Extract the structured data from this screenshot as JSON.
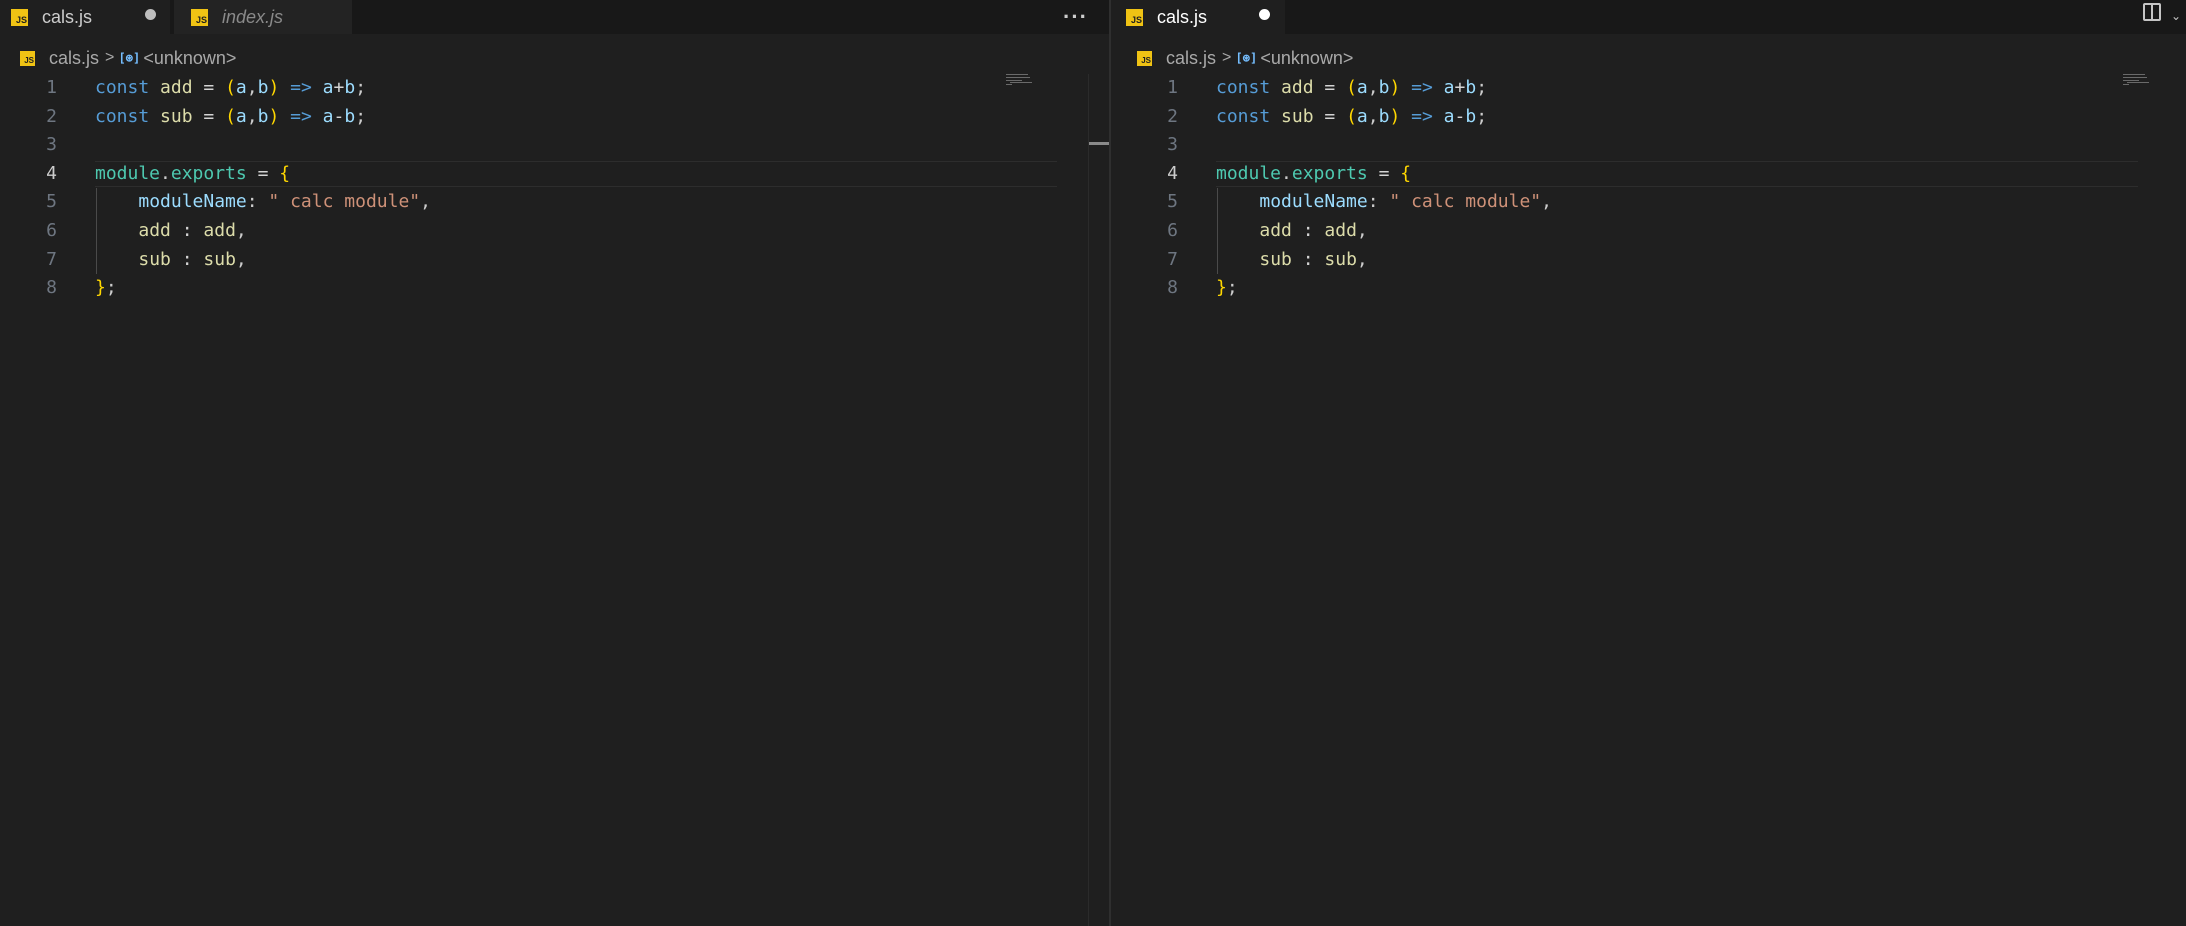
{
  "left_pane": {
    "tabs": [
      {
        "label": "cals.js",
        "badge": "JS",
        "dirty": true,
        "active": true
      },
      {
        "label": "index.js",
        "badge": "JS",
        "dirty": false,
        "active": false,
        "preview": true
      }
    ],
    "more_actions": "···",
    "breadcrumb": {
      "file": "cals.js",
      "separator": ">",
      "symbol_icon": "symbol-variable-icon",
      "symbol": "<unknown>"
    }
  },
  "right_pane": {
    "tabs": [
      {
        "label": "cals.js",
        "badge": "JS",
        "dirty": true,
        "active": true
      }
    ],
    "breadcrumb": {
      "file": "cals.js",
      "separator": ">",
      "symbol_icon": "symbol-variable-icon",
      "symbol": "<unknown>"
    },
    "actions": {
      "split_editor_icon": "split-editor-icon"
    }
  },
  "editor": {
    "active_line": 4,
    "lines": [
      {
        "n": "1",
        "t": [
          "const",
          " ",
          "add",
          " = ",
          "(",
          "a",
          ",",
          "b",
          ")",
          " ",
          "=>",
          " ",
          "a",
          "+",
          "b",
          ";"
        ]
      },
      {
        "n": "2",
        "t": [
          "const",
          " ",
          "sub",
          " = ",
          "(",
          "a",
          ",",
          "b",
          ")",
          " ",
          "=>",
          " ",
          "a",
          "-",
          "b",
          ";"
        ]
      },
      {
        "n": "3",
        "t": []
      },
      {
        "n": "4",
        "t": [
          "module",
          ".",
          "exports",
          " = ",
          "{"
        ]
      },
      {
        "n": "5",
        "t": [
          "    ",
          "moduleName",
          ": ",
          "\" calc module\"",
          ","
        ]
      },
      {
        "n": "6",
        "t": [
          "    ",
          "add",
          " : ",
          "add",
          ","
        ]
      },
      {
        "n": "7",
        "t": [
          "    ",
          "sub",
          " : ",
          "sub",
          ","
        ]
      },
      {
        "n": "8",
        "t": [
          "}",
          ";"
        ]
      }
    ],
    "token_classes": [
      [
        "kw",
        "op",
        "fn",
        "op",
        "paren",
        "var",
        "punc",
        "var",
        "paren",
        "op",
        "kw",
        "op",
        "var",
        "op",
        "var",
        "punc"
      ],
      [
        "kw",
        "op",
        "fn",
        "op",
        "paren",
        "var",
        "punc",
        "var",
        "paren",
        "op",
        "kw",
        "op",
        "var",
        "op",
        "var",
        "punc"
      ],
      [],
      [
        "obj",
        "punc",
        "obj",
        "op",
        "paren"
      ],
      [
        "op",
        "prop",
        "punc",
        "str",
        "punc"
      ],
      [
        "op",
        "fn",
        "op",
        "fn",
        "punc"
      ],
      [
        "op",
        "fn",
        "op",
        "fn",
        "punc"
      ],
      [
        "paren",
        "punc"
      ]
    ]
  },
  "colors": {
    "background": "#1f1f1f",
    "tabbar": "#181818",
    "js_badge": "#f0c314",
    "keyword": "#569cd6",
    "function": "#dcdcaa",
    "variable": "#9cdcfe",
    "string": "#ce9178",
    "bracket": "#ffd700",
    "type": "#4ec9b0"
  }
}
